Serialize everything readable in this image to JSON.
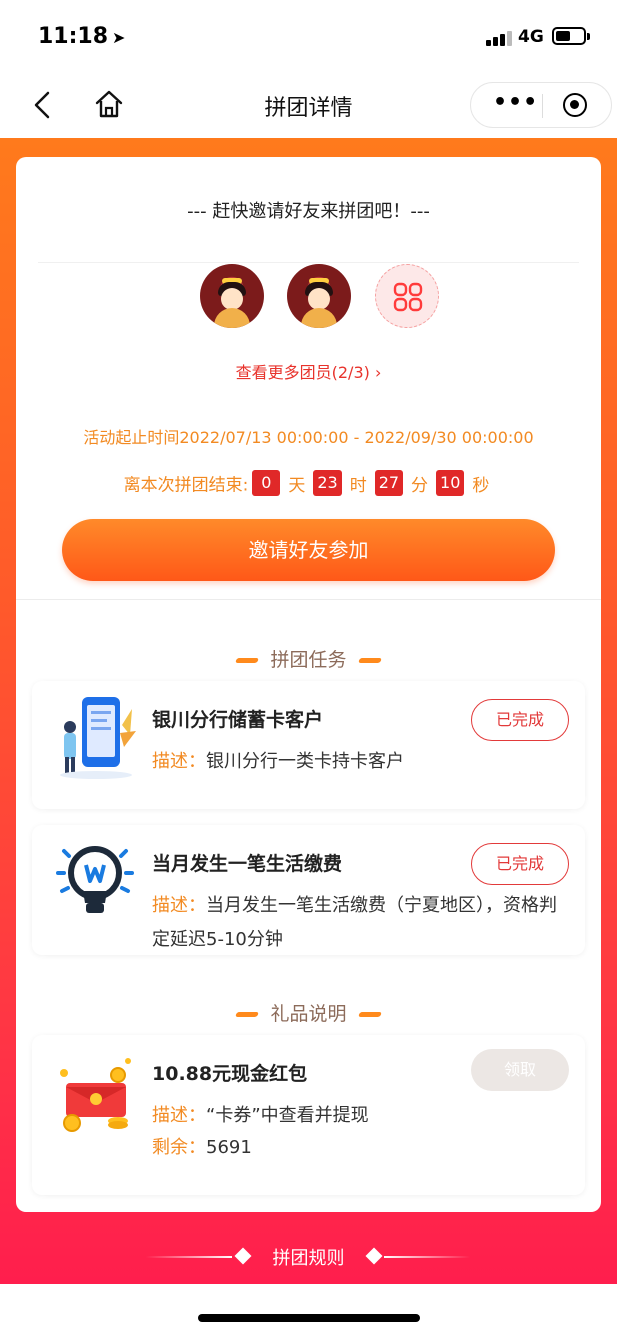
{
  "status_bar": {
    "time": "11:18",
    "network": "4G"
  },
  "nav": {
    "title": "拼团详情"
  },
  "invite": {
    "heading": "--- 赶快邀请好友来拼团吧！---",
    "view_more": "查看更多团员(2/3) ›",
    "activity_time": "活动起止时间2022/07/13 00:00:00 - 2022/09/30 00:00:00",
    "countdown": {
      "label": "离本次拼团结束:",
      "days": "0",
      "days_unit": "天",
      "hours": "23",
      "hours_unit": "时",
      "minutes": "27",
      "minutes_unit": "分",
      "seconds": "10",
      "seconds_unit": "秒"
    },
    "invite_button": "邀请好友参加"
  },
  "tasks_section": {
    "title": "拼团任务",
    "tasks": [
      {
        "title": "银川分行储蓄卡客户",
        "desc_label": "描述：",
        "desc": "银川分行一类卡持卡客户",
        "status": "已完成"
      },
      {
        "title": "当月发生一笔生活缴费",
        "desc_label": "描述：",
        "desc": "当月发生一笔生活缴费（宁夏地区），资格判定延迟5-10分钟",
        "status": "已完成"
      }
    ]
  },
  "gift_section": {
    "title": "礼品说明",
    "gift": {
      "title": "10.88元现金红包",
      "desc_label": "描述：",
      "desc": "“卡券”中查看并提现",
      "remaining_label": "剩余：",
      "remaining": "5691",
      "claim_button": "领取"
    }
  },
  "footer": {
    "rules_label": "拼团规则"
  },
  "colors": {
    "accent_orange": "#f28a22",
    "accent_red": "#e23a3a",
    "gradient_top": "#ff7a1c",
    "gradient_bottom": "#ff1e4d"
  }
}
